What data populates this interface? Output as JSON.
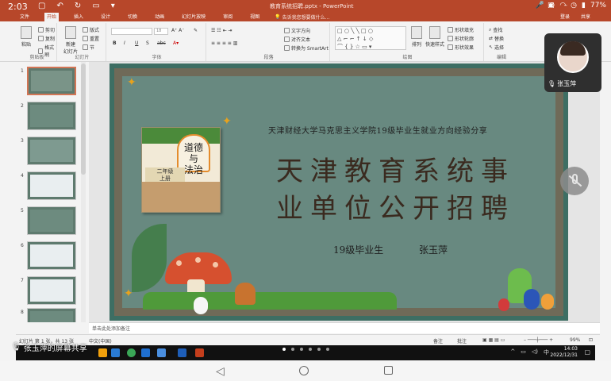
{
  "status_bar": {
    "time": "2:03",
    "battery": "77%"
  },
  "app": {
    "document_title": "教育系统招聘.pptx - PowerPoint",
    "window_controls": [
      "登录",
      "共享"
    ]
  },
  "ribbon": {
    "tabs": [
      "文件",
      "开始",
      "插入",
      "设计",
      "切换",
      "动画",
      "幻灯片放映",
      "审阅",
      "视图"
    ],
    "active_tab": "开始",
    "search_placeholder": "告诉我您想要做什么...",
    "groups": {
      "clipboard": {
        "label": "剪贴板",
        "paste": "粘贴",
        "cut": "剪切",
        "copy": "复制",
        "format_painter": "格式刷"
      },
      "slides": {
        "label": "幻灯片",
        "new_slide": "新建\n幻灯片",
        "layout": "版式",
        "reset": "重置",
        "section": "节"
      },
      "font": {
        "label": "字体",
        "size": "18",
        "bold": "B",
        "italic": "I",
        "underline": "U",
        "shadow": "S",
        "strike": "abc"
      },
      "paragraph": {
        "label": "段落",
        "text_direction": "文字方向",
        "align_text": "对齐文本",
        "smartart": "转换为 SmartArt"
      },
      "drawing": {
        "label": "绘图",
        "arrange": "排列",
        "quick_styles": "快速样式",
        "shape_fill": "形状填充",
        "shape_outline": "形状轮廓",
        "shape_effects": "形状效果"
      },
      "editing": {
        "label": "编辑",
        "find": "查找",
        "replace": "替换",
        "select": "选择"
      }
    }
  },
  "slide_panel": {
    "numbers": [
      "1",
      "2",
      "3",
      "4",
      "5",
      "6",
      "7",
      "8"
    ]
  },
  "slide": {
    "subtitle": "天津财经大学马克思主义学院19级毕业生就业方向经验分享",
    "title_line1": "天津教育系统事",
    "title_line2": "业单位公开招聘",
    "grad_label": "19级毕业生",
    "author": "张玉萍",
    "book": {
      "title": "道德\n与\n法治",
      "grade": "二年级\n上册"
    }
  },
  "notes_placeholder": "单击此处添加备注",
  "ppt_status": {
    "slide_info": "幻灯片 第 1 张，共 13 张",
    "language": "中文(中国)",
    "notes": "备注",
    "comments": "批注",
    "zoom": "99%"
  },
  "taskbar": {
    "time": "14:03",
    "date": "2022/12/31"
  },
  "screen_share_label": "张玉萍的屏幕共享",
  "video_tile": {
    "name": "张玉萍"
  },
  "colors": {
    "ppt_accent": "#b7472a",
    "slide_board": "#688980",
    "slide_frame": "#6f6a58"
  }
}
